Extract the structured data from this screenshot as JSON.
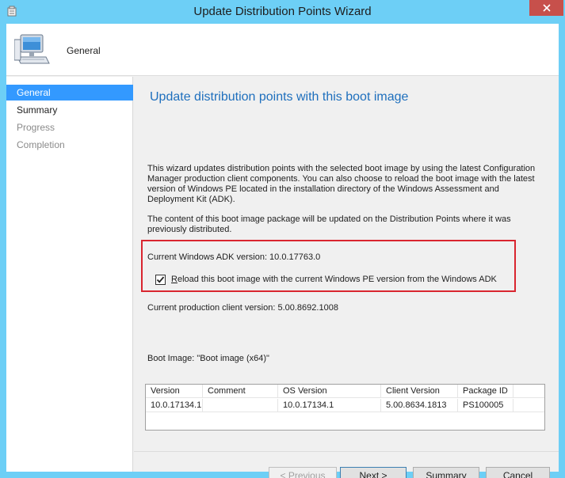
{
  "window": {
    "title": "Update Distribution Points Wizard"
  },
  "header": {
    "title": "General",
    "icon": "computer-icon"
  },
  "sidebar": {
    "items": [
      {
        "label": "General",
        "state": "active"
      },
      {
        "label": "Summary",
        "state": "normal"
      },
      {
        "label": "Progress",
        "state": "disabled"
      },
      {
        "label": "Completion",
        "state": "disabled"
      }
    ]
  },
  "main": {
    "heading": "Update distribution points with this boot image",
    "description": "This wizard updates distribution points with the selected boot image by using the latest Configuration Manager production client components. You can also choose to reload the boot image with the latest version of Windows PE located in the installation directory of the Windows Assessment and Deployment Kit (ADK).",
    "content_note": "The content of this boot image package will be updated on the Distribution Points where it was previously distributed.",
    "adk_version": "Current Windows ADK version: 10.0.17763.0",
    "reload_checkbox": {
      "checked": true,
      "accel": "R",
      "label_rest": "eload this boot image with the current Windows PE version from the Windows ADK"
    },
    "client_version": "Current production client version: 5.00.8692.1008",
    "boot_image": "Boot Image: \"Boot image (x64)\""
  },
  "table": {
    "columns": [
      "Version",
      "Comment",
      "OS Version",
      "Client Version",
      "Package ID"
    ],
    "rows": [
      [
        "10.0.17134.1",
        "",
        "10.0.17134.1",
        "5.00.8634.1813",
        "PS100005"
      ]
    ]
  },
  "buttons": {
    "previous": {
      "accel": "",
      "text": "< Previous",
      "enabled": false
    },
    "next_accel": "N",
    "next_rest": "ext >",
    "summary_accel": "S",
    "summary_rest": "ummary",
    "cancel": "Cancel"
  },
  "colors": {
    "titlebar": "#6dcff6",
    "close_button": "#c7504b",
    "active_nav": "#3399ff",
    "heading": "#1e6fbd",
    "highlight_box": "#d9252f"
  }
}
